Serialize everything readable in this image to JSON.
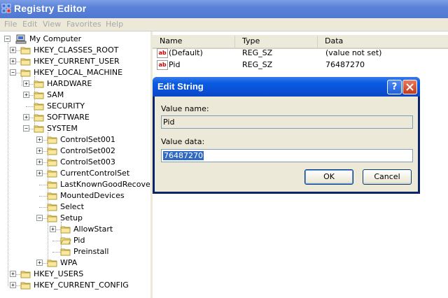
{
  "window": {
    "title": "Registry Editor"
  },
  "menu": [
    "File",
    "Edit",
    "View",
    "Favorites",
    "Help"
  ],
  "tree": {
    "root": "My Computer",
    "items": [
      "HKEY_CLASSES_ROOT",
      "HKEY_CURRENT_USER",
      "HKEY_LOCAL_MACHINE",
      "HARDWARE",
      "SAM",
      "SECURITY",
      "SOFTWARE",
      "SYSTEM",
      "ControlSet001",
      "ControlSet002",
      "ControlSet003",
      "CurrentControlSet",
      "LastKnownGoodRecove",
      "MountedDevices",
      "Select",
      "Setup",
      "AllowStart",
      "Pid",
      "Preinstall",
      "WPA",
      "HKEY_USERS",
      "HKEY_CURRENT_CONFIG"
    ]
  },
  "list": {
    "columns": [
      "Name",
      "Type",
      "Data"
    ],
    "rows": [
      {
        "name": "(Default)",
        "type": "REG_SZ",
        "data": "(value not set)"
      },
      {
        "name": "Pid",
        "type": "REG_SZ",
        "data": "76487270"
      }
    ]
  },
  "dialog": {
    "title": "Edit String",
    "help": "?",
    "close": "X",
    "value_name_label": "Value name:",
    "value_name": "Pid",
    "value_data_label": "Value data:",
    "value_data": "76487270",
    "ok": "OK",
    "cancel": "Cancel"
  }
}
